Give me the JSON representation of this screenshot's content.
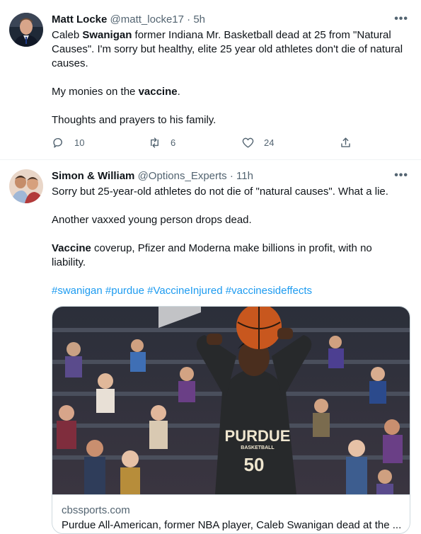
{
  "tweets": [
    {
      "name": "Matt Locke",
      "handle": "@matt_locke17",
      "sep": "·",
      "time": "5h",
      "more": "•••",
      "lines": {
        "l1a": "Caleb ",
        "l1b": "Swanigan",
        "l1c": " former Indiana Mr. Basketball dead at 25 from \"Natural",
        "l2": "Causes\". I'm sorry but healthy, elite 25 year old athletes don't die of natural",
        "l3": "causes.",
        "l4a": "My monies on the ",
        "l4b": "vaccine",
        "l4c": ".",
        "l5": "Thoughts and prayers to his family."
      },
      "actions": {
        "replies": "10",
        "retweets": "6",
        "likes": "24"
      }
    },
    {
      "name": "Simon & William",
      "handle": "@Options_Experts",
      "sep": "·",
      "time": "11h",
      "more": "•••",
      "lines": {
        "l1": "Sorry but 25-year-old athletes do not die of \"natural causes\".  What a lie.",
        "l2": "Another vaxxed young person drops dead.",
        "l3a": "Vaccine",
        "l3b": " coverup, Pfizer and Moderna make billions in profit, with no",
        "l4": "liability."
      },
      "hashtags": [
        "#swanigan",
        "#purdue",
        "#VaccineInjured",
        "#vaccinesideffects"
      ],
      "card": {
        "jersey_text": "PURDUE",
        "jersey_sub": "BASKETBALL",
        "jersey_number": "50",
        "domain": "cbssports.com",
        "title": "Purdue All-American, former NBA player, Caleb Swanigan dead at the ..."
      }
    }
  ],
  "icons": [
    "reply-icon",
    "retweet-icon",
    "like-icon",
    "share-icon",
    "more-icon"
  ],
  "colors": {
    "link": "#1d9bf0",
    "muted": "#536471",
    "text": "#0f1419",
    "border": "#cfd9de"
  }
}
